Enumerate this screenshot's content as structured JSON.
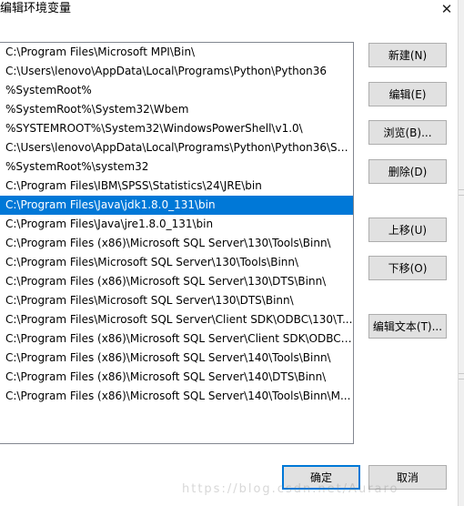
{
  "window": {
    "title": "编辑环境变量",
    "close_glyph": "✕"
  },
  "path_list": {
    "selected_index": 8,
    "items": [
      "C:\\Program Files\\Microsoft MPI\\Bin\\",
      "C:\\Users\\lenovo\\AppData\\Local\\Programs\\Python\\Python36",
      "%SystemRoot%",
      "%SystemRoot%\\System32\\Wbem",
      "%SYSTEMROOT%\\System32\\WindowsPowerShell\\v1.0\\",
      "C:\\Users\\lenovo\\AppData\\Local\\Programs\\Python\\Python36\\Scr...",
      "%SystemRoot%\\system32",
      "C:\\Program Files\\IBM\\SPSS\\Statistics\\24\\JRE\\bin",
      "C:\\Program Files\\Java\\jdk1.8.0_131\\bin",
      "C:\\Program Files\\Java\\jre1.8.0_131\\bin",
      "C:\\Program Files (x86)\\Microsoft SQL Server\\130\\Tools\\Binn\\",
      "C:\\Program Files\\Microsoft SQL Server\\130\\Tools\\Binn\\",
      "C:\\Program Files (x86)\\Microsoft SQL Server\\130\\DTS\\Binn\\",
      "C:\\Program Files\\Microsoft SQL Server\\130\\DTS\\Binn\\",
      "C:\\Program Files\\Microsoft SQL Server\\Client SDK\\ODBC\\130\\T...",
      "C:\\Program Files (x86)\\Microsoft SQL Server\\Client SDK\\ODBC\\...",
      "C:\\Program Files (x86)\\Microsoft SQL Server\\140\\Tools\\Binn\\",
      "C:\\Program Files (x86)\\Microsoft SQL Server\\140\\DTS\\Binn\\",
      "C:\\Program Files (x86)\\Microsoft SQL Server\\140\\Tools\\Binn\\M..."
    ]
  },
  "buttons": {
    "new": "新建(N)",
    "edit": "编辑(E)",
    "browse": "浏览(B)...",
    "delete": "删除(D)",
    "move_up": "上移(U)",
    "move_down": "下移(O)",
    "edit_text": "编辑文本(T)...",
    "ok": "确定",
    "cancel": "取消"
  },
  "watermark": "https://blog.csdn.net/Auraro",
  "colors": {
    "selection": "#0078d7",
    "button_face": "#e1e1e1",
    "button_border": "#adadad",
    "list_border": "#828790"
  }
}
